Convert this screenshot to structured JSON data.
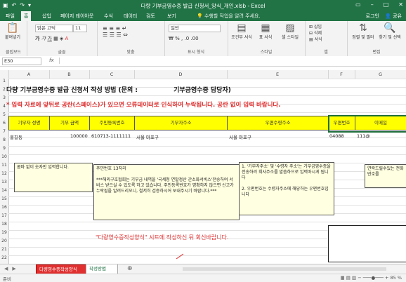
{
  "window": {
    "title": "다량 기부금영수증 발급 신청서_양식_개인.xlsb - Excel"
  },
  "ribbon_tabs": [
    "파일",
    "홈",
    "삽입",
    "페이지 레이아웃",
    "수식",
    "데이터",
    "검토",
    "보기"
  ],
  "tell_me": "수행할 작업을 알려 주세요.",
  "account": {
    "login": "로그인",
    "share": "공유"
  },
  "ribbon": {
    "clipboard": {
      "label": "클립보드",
      "paste": "붙여넣기"
    },
    "font": {
      "label": "글꼴",
      "name": "맑은 고딕",
      "size": "11"
    },
    "alignment": {
      "label": "맞춤"
    },
    "number": {
      "label": "표시 형식",
      "format": "일반"
    },
    "styles": {
      "label": "스타일",
      "conditional": "조건부 서식",
      "table": "표 서식",
      "cell": "셀 스타일"
    },
    "cells": {
      "label": "셀",
      "insert": "삽입",
      "delete": "삭제",
      "format": "서식"
    },
    "editing": {
      "label": "편집",
      "sort": "정렬 및 필터",
      "find": "찾기 및 선택"
    }
  },
  "formula_bar": {
    "name_box": "E30",
    "value": ""
  },
  "columns": [
    "A",
    "B",
    "C",
    "D",
    "E",
    "F",
    "G"
  ],
  "rows": [
    "1",
    "2",
    "3",
    "4",
    "5",
    "6",
    "7",
    "8",
    "9",
    "10",
    "11",
    "12",
    "13",
    "14",
    "15",
    "16",
    "17",
    "18",
    "19",
    "20",
    "21",
    "22"
  ],
  "sheet": {
    "title": "다량 기부금영수증 발급 신청서 작성 방법 (문의 :",
    "title_right": "기부금영수증 담당자)",
    "warning": "* 입력 자료에 앞뒤로 공란(스페이스)가 있으면 오류데이터로 인식하여 누락됩니다. 공란 없이 입력 바랍니다.",
    "headers": [
      "기부자 성명",
      "기부 금액",
      "주민등록번호",
      "기부자주소",
      "우편수령주소",
      "우편번호",
      "이메일"
    ],
    "row": [
      "홍길동",
      "100000",
      "610713-1111111",
      "서울 마포구",
      "서울 마포구",
      "04088",
      "111@"
    ],
    "notes": [
      "콤마 없이 숫자만 입력합니다.",
      "주민번호 13자리\n\n***해외구호협회는 기부금 내역을 '국세청 연말정산 간소화서비스'전송하여 서비스 받으실 수 있도록 하고 있습니다. 주민등록번호가 명확하지 않으면 신고가 누락될을 알려드리오니, 철저히 검증하시어 보내주시기 바랍니다.***",
      "1. '기부자주소' 및 '수령자 주소'는 기부금영수증을 전송하려 회사주소를 말씀하으로 입력바시게 됩니다\n\n2. 우편번호는 수령자주소에 해당하는 우편번호입니다",
      "연락드릴수있는 전화번호를"
    ],
    "footer_note": "\"다량영수증작성양식\" 시트에 작성하신 뒤 회신바랍니다."
  },
  "sheet_tabs": [
    {
      "label": "다량영수증작성양식",
      "active": true
    },
    {
      "label": "작성방법",
      "active": false
    }
  ],
  "status": {
    "left": "준비",
    "zoom": "85 %"
  }
}
